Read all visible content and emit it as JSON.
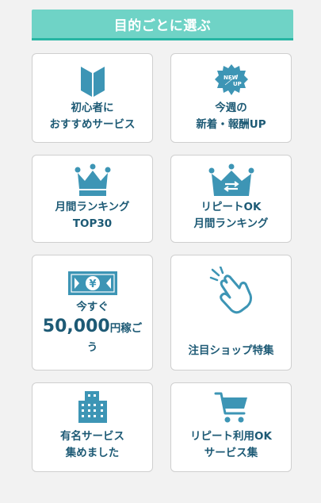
{
  "header": {
    "title": "目的ごとに選ぶ"
  },
  "colors": {
    "accent": "#6fd3c6",
    "accent_dark": "#27b5a3",
    "icon": "#3d95b5",
    "text": "#1d5a75"
  },
  "cards": [
    {
      "icon": "beginner-mark-icon",
      "line1": "初心者に",
      "line2": "おすすめサービス"
    },
    {
      "icon": "new-up-badge-icon",
      "badge_new": "NEW",
      "badge_up": "UP",
      "line1": "今週の",
      "line2": "新着・報酬UP"
    },
    {
      "icon": "crown-icon",
      "line1": "月間ランキング",
      "line2": "TOP30"
    },
    {
      "icon": "crown-repeat-icon",
      "line1": "リピートOK",
      "line2": "月間ランキング"
    },
    {
      "icon": "yen-banknote-icon",
      "banknote_symbol": "¥",
      "line1": "今すぐ",
      "amount": "50,000",
      "unit": "円稼ご",
      "line3": "う"
    },
    {
      "icon": "pointing-hand-icon",
      "line1": "注目ショップ特集"
    },
    {
      "icon": "building-icon",
      "line1": "有名サービス",
      "line2": "集めました"
    },
    {
      "icon": "shopping-cart-icon",
      "line1": "リピート利用OK",
      "line2": "サービス集"
    }
  ]
}
